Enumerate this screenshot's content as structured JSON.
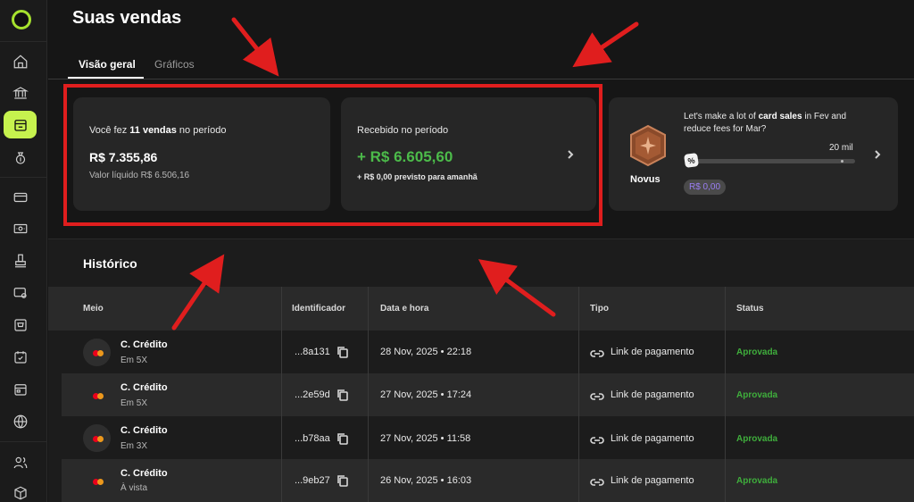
{
  "page": {
    "title": "Suas vendas",
    "tabs": [
      {
        "label": "Visão geral",
        "active": true
      },
      {
        "label": "Gráficos",
        "active": false
      }
    ]
  },
  "summary": {
    "sales": {
      "prefix": "Você fez ",
      "count_text": "11 vendas",
      "suffix": " no período",
      "amount": "R$ 7.355,86",
      "net_label": "Valor líquido R$ 6.506,16"
    },
    "received": {
      "label": "Recebido no período",
      "amount": "+ R$ 6.605,60",
      "forecast": "+ R$ 0,00 previsto para amanhã"
    },
    "goal": {
      "level": "Novus",
      "text_before": "Let's make a lot of ",
      "text_bold": "card sales",
      "text_after": " in Fev and reduce fees for Mar?",
      "max_label": "20 mil",
      "current_label": "R$ 0,00",
      "handle_symbol": "%",
      "progress_fraction": 0.0
    }
  },
  "history": {
    "title": "Histórico",
    "columns": [
      "Meio",
      "Identificador",
      "Data e hora",
      "Tipo",
      "Status"
    ],
    "rows": [
      {
        "method": "C. Crédito",
        "installments": "Em 5X",
        "id": "...8a131",
        "datetime": "28 Nov, 2025 • 22:18",
        "type": "Link de pagamento",
        "status": "Aprovada"
      },
      {
        "method": "C. Crédito",
        "installments": "Em 5X",
        "id": "...2e59d",
        "datetime": "27 Nov, 2025 • 17:24",
        "type": "Link de pagamento",
        "status": "Aprovada"
      },
      {
        "method": "C. Crédito",
        "installments": "Em 3X",
        "id": "...b78aa",
        "datetime": "27 Nov, 2025 • 11:58",
        "type": "Link de pagamento",
        "status": "Aprovada"
      },
      {
        "method": "C. Crédito",
        "installments": "À vista",
        "id": "...9eb27",
        "datetime": "26 Nov, 2025 • 16:03",
        "type": "Link de pagamento",
        "status": "Aprovada"
      }
    ]
  },
  "colors": {
    "accent": "#c6f24e",
    "positive": "#4cbb4a",
    "status_approved": "#3fae3c",
    "highlight": "#e01e1e",
    "goal_value": "#9a7ef2"
  },
  "icons": {
    "sidebar": [
      "home-icon",
      "bank-icon",
      "store-icon",
      "money-bag-icon",
      "card-icon",
      "banknote-icon",
      "pos-terminal-icon",
      "settings-card-icon",
      "cart-icon",
      "calendar-check-icon",
      "wallet-icon",
      "globe-icon",
      "users-icon",
      "box-icon"
    ]
  }
}
